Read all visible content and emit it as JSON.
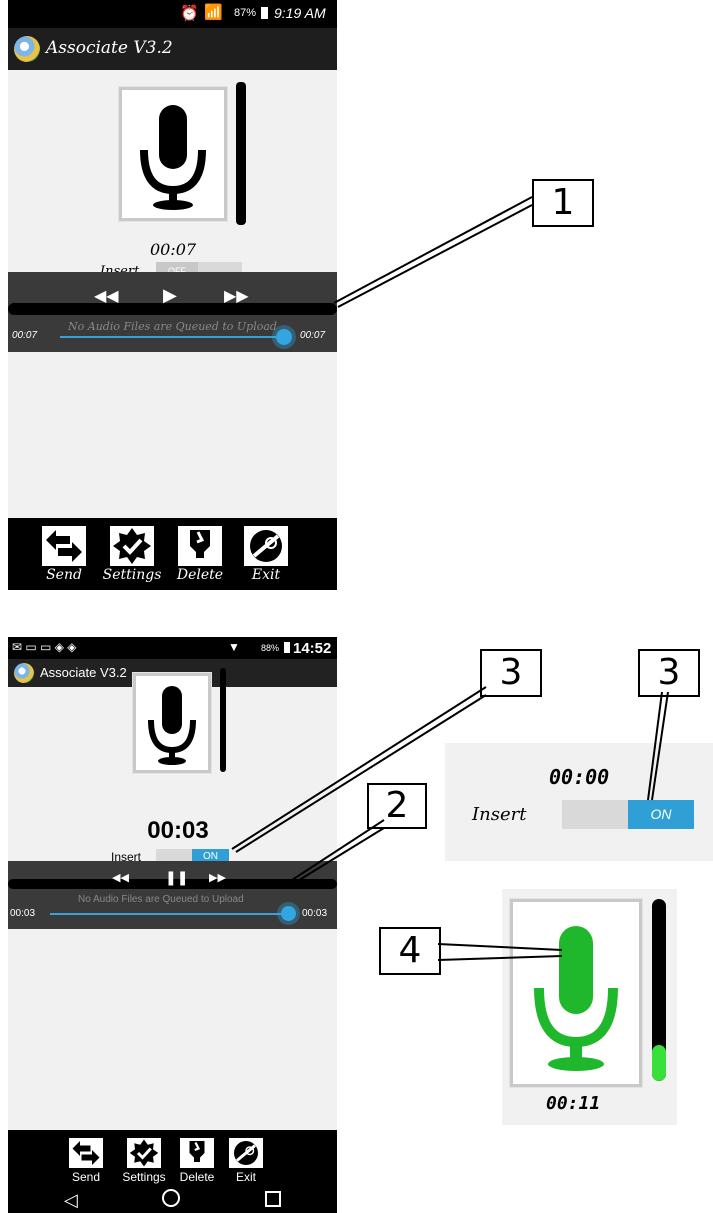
{
  "top": {
    "status": {
      "battery": "87%",
      "time": "9:19 AM"
    },
    "app_title": "Associate V3.2",
    "timer": "00:07",
    "insert_label": "Insert",
    "insert_state": "OFF",
    "queue_text": "No Audio Files are Queued to Upload",
    "pos_left": "00:07",
    "pos_right": "00:07",
    "callout": "1"
  },
  "bottom": {
    "status": {
      "battery": "88%",
      "time": "14:52"
    },
    "app_title": "Associate V3.2",
    "timer": "00:03",
    "insert_label": "Insert",
    "insert_state": "ON",
    "queue_text": "No Audio Files are Queued to Upload",
    "pos_left": "00:03",
    "pos_right": "00:03",
    "callout_2": "2",
    "callout_3": "3"
  },
  "toolbar": {
    "send": "Send",
    "settings": "Settings",
    "delete": "Delete",
    "exit": "Exit"
  },
  "inset_switch": {
    "timer": "00:00",
    "insert_label": "Insert",
    "state": "ON",
    "callout": "3"
  },
  "inset_mic": {
    "timer": "00:11",
    "callout": "4",
    "mic_color": "#1fb82c",
    "level_fraction": 0.2
  },
  "colors": {
    "accent": "#2f9fd6",
    "record_green": "#1fb82c"
  }
}
